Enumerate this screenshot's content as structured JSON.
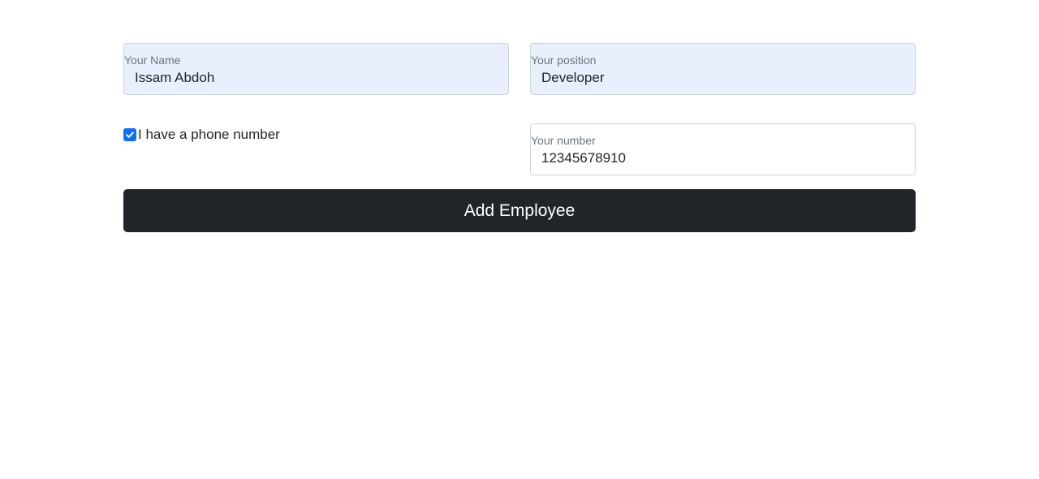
{
  "form": {
    "name": {
      "label": "Your Name",
      "value": "Issam Abdoh"
    },
    "position": {
      "label": "Your position",
      "value": "Developer"
    },
    "phone_checkbox": {
      "label": "I have a phone number",
      "checked": true
    },
    "number": {
      "label": "Your number",
      "value": "12345678910"
    },
    "submit_label": "Add Employee"
  },
  "colors": {
    "autofill_bg": "#e8f0fe",
    "checkbox_accent": "#0d6efd",
    "button_bg": "#212529",
    "button_text": "#ffffff"
  }
}
